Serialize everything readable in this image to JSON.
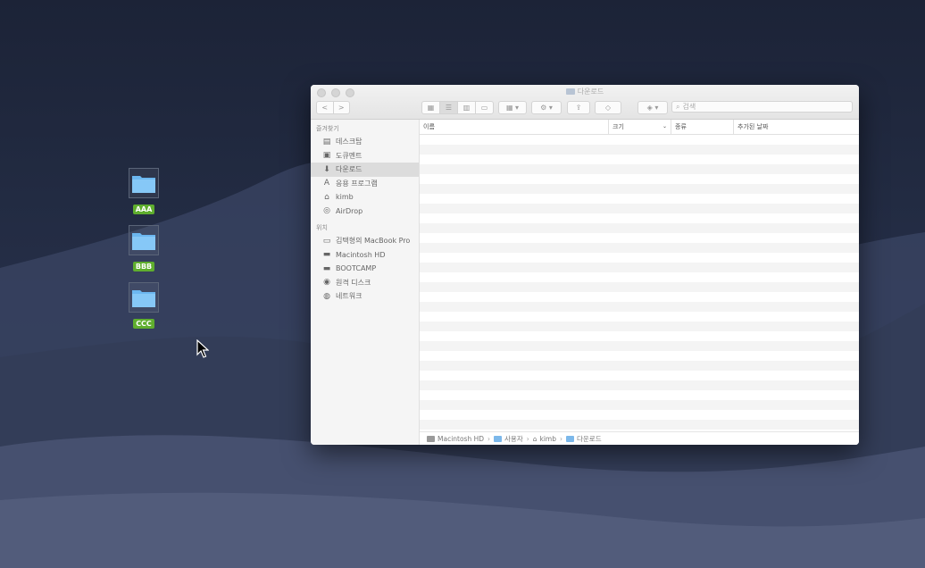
{
  "desktop": {
    "icons": [
      {
        "label": "AAA"
      },
      {
        "label": "BBB"
      },
      {
        "label": "CCC"
      }
    ]
  },
  "window": {
    "title": "다운로드",
    "search_placeholder": "검색",
    "nav": {
      "back": "<",
      "forward": ">"
    },
    "sidebar": {
      "favorites_header": "즐겨찾기",
      "favorites": [
        {
          "label": "데스크탑",
          "icon": "desktop-icon"
        },
        {
          "label": "도큐멘트",
          "icon": "document-icon"
        },
        {
          "label": "다운로드",
          "icon": "download-icon",
          "selected": true
        },
        {
          "label": "응용 프로그램",
          "icon": "applications-icon"
        },
        {
          "label": "kimb",
          "icon": "home-icon"
        },
        {
          "label": "AirDrop",
          "icon": "airdrop-icon"
        }
      ],
      "locations_header": "위치",
      "locations": [
        {
          "label": "김택형의 MacBook Pro",
          "icon": "laptop-icon"
        },
        {
          "label": "Macintosh HD",
          "icon": "disk-icon"
        },
        {
          "label": "BOOTCAMP",
          "icon": "disk-icon"
        },
        {
          "label": "원격 디스크",
          "icon": "remote-disc-icon"
        },
        {
          "label": "네트워크",
          "icon": "network-icon"
        }
      ]
    },
    "columns": {
      "name": "이름",
      "size": "크기",
      "kind": "종류",
      "date_added": "추가된 날짜"
    },
    "pathbar": [
      "Macintosh HD",
      "사용자",
      "kimb",
      "다운로드"
    ]
  },
  "colors": {
    "tag_green": "#5fae2e",
    "folder_blue": "#6cb7f0"
  }
}
